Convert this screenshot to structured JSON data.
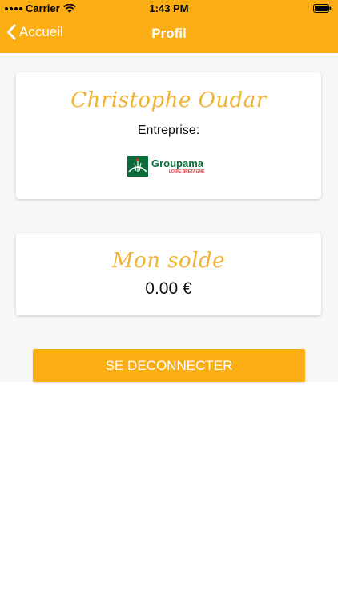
{
  "status_bar": {
    "carrier": "Carrier",
    "time": "1:43 PM",
    "icons": [
      "signal-icon",
      "wifi-icon",
      "battery-icon"
    ]
  },
  "nav": {
    "back_label": "Accueil",
    "title": "Profil"
  },
  "profile": {
    "name": "Christophe Oudar",
    "company_label": "Entreprise:",
    "company_logo": {
      "brand": "Groupama",
      "subtitle": "LOIRE BRETAGNE"
    }
  },
  "balance": {
    "title": "Mon solde",
    "value": "0.00 €"
  },
  "actions": {
    "logout_label": "SE DECONNECTER"
  },
  "colors": {
    "accent": "#FBAE14",
    "script_text": "#F2B233",
    "content_background": "#F7F7F7",
    "logo_green": "#0B6B3A",
    "logo_red": "#D6322C"
  }
}
